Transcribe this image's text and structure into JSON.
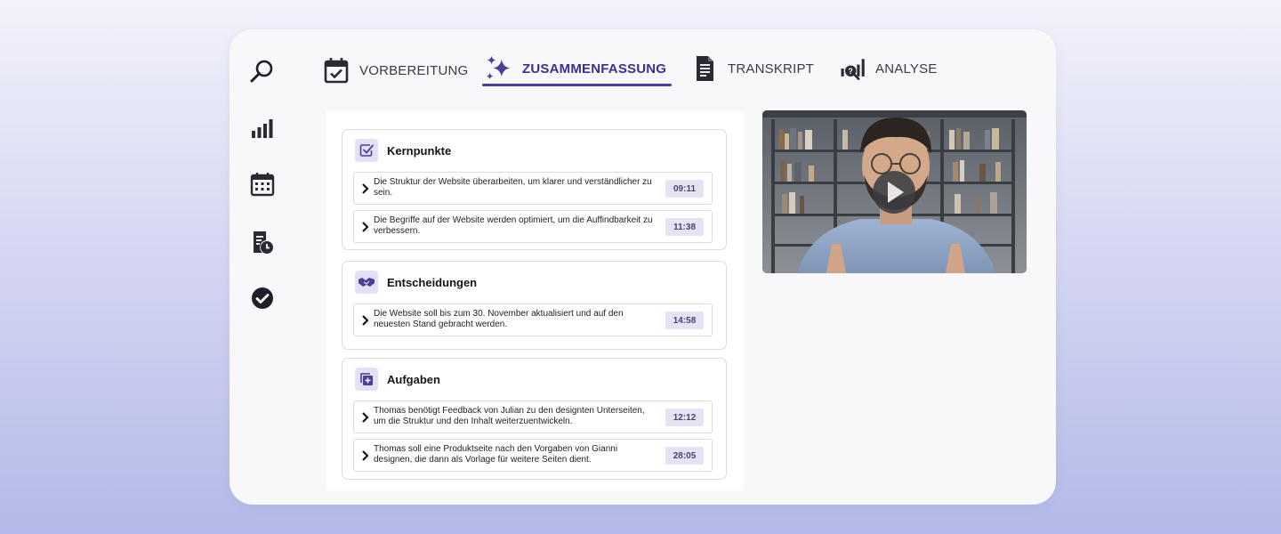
{
  "tabs": [
    {
      "label": "VORBEREITUNG",
      "icon": "calendar-check-icon"
    },
    {
      "label": "ZUSAMMENFASSUNG",
      "icon": "sparkles-icon"
    },
    {
      "label": "TRANSKRIPT",
      "icon": "document-icon"
    },
    {
      "label": "ANALYSE",
      "icon": "analytics-icon"
    }
  ],
  "active_tab": "ZUSAMMENFASSUNG",
  "sidebar": [
    "search-icon",
    "bar-chart-icon",
    "calendar-icon",
    "report-clock-icon",
    "check-circle-icon"
  ],
  "sections": [
    {
      "title": "Kernpunkte",
      "icon": "checkbox-icon",
      "items": [
        {
          "text": "Die Struktur der Website überarbeiten, um klarer und verständlicher zu sein.",
          "time": "09:11"
        },
        {
          "text": "Die Begriffe auf der Website werden optimiert, um die Auffindbarkeit zu verbessern.",
          "time": "11:38"
        }
      ]
    },
    {
      "title": "Entscheidungen",
      "icon": "handshake-icon",
      "items": [
        {
          "text": "Die Website soll bis zum 30. November aktualisiert und auf den neuesten Stand gebracht werden.",
          "time": "14:58"
        }
      ]
    },
    {
      "title": "Aufgaben",
      "icon": "add-task-icon",
      "items": [
        {
          "text": "Thomas benötigt Feedback von Julian zu den designten Unterseiten, um die Struktur und den Inhalt weiterzuentwickeln.",
          "time": "12:12"
        },
        {
          "text": "Thomas soll eine Produktseite nach den Vorgaben von Gianni designen, die dann als Vorlage für weitere Seiten dient.",
          "time": "28:05"
        }
      ]
    }
  ],
  "video": {
    "icon": "play-icon"
  },
  "colors": {
    "accent": "#4b3e99",
    "badge_bg": "#e6e4f4",
    "icon_bg": "#e4e1f5"
  }
}
